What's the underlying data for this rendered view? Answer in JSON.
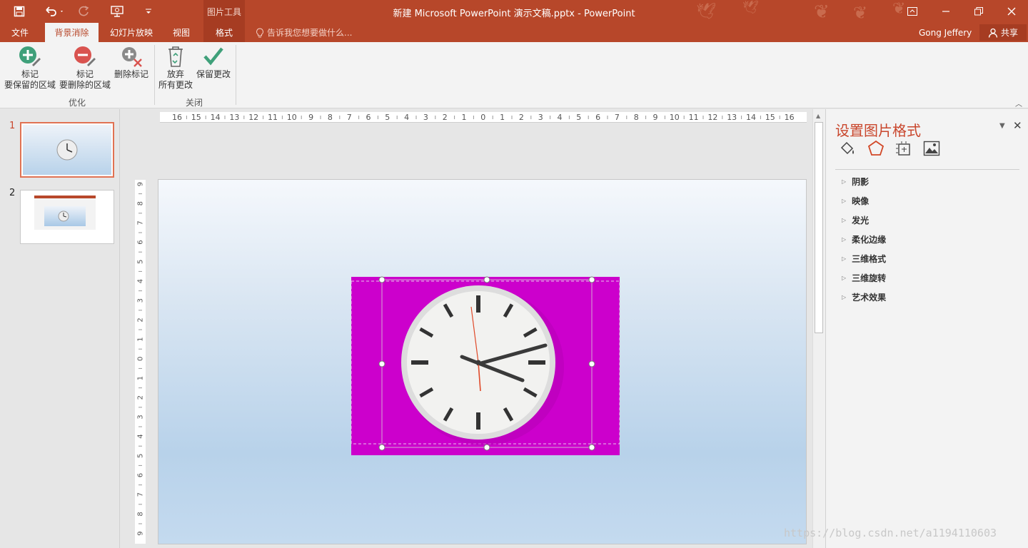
{
  "window": {
    "title": "新建 Microsoft PowerPoint 演示文稿.pptx - PowerPoint",
    "context_tools_label": "图片工具"
  },
  "tabs": [
    {
      "label": "文件",
      "active": false
    },
    {
      "label": "背景消除",
      "active": true
    },
    {
      "label": "幻灯片放映",
      "active": false
    },
    {
      "label": "视图",
      "active": false
    },
    {
      "label": "格式",
      "active": false
    }
  ],
  "tell_me": "告诉我您想要做什么...",
  "user_name": "Gong Jeffery",
  "share_label": "共享",
  "ribbon": {
    "group_refine": {
      "label": "优化",
      "mark_keep": [
        "标记",
        "要保留的区域"
      ],
      "mark_remove": [
        "标记",
        "要删除的区域"
      ],
      "delete_mark": "删除标记"
    },
    "group_close": {
      "label": "关闭",
      "discard": [
        "放弃",
        "所有更改"
      ],
      "keep": "保留更改"
    }
  },
  "slides": [
    {
      "number": "1",
      "selected": true
    },
    {
      "number": "2",
      "selected": false
    }
  ],
  "ruler": {
    "h_labels": [
      "16",
      "15",
      "14",
      "13",
      "12",
      "11",
      "10",
      "9",
      "8",
      "7",
      "6",
      "5",
      "4",
      "3",
      "2",
      "1",
      "0",
      "1",
      "2",
      "3",
      "4",
      "5",
      "6",
      "7",
      "8",
      "9",
      "10",
      "11",
      "12",
      "13",
      "14",
      "15",
      "16"
    ],
    "v_labels": [
      "9",
      "8",
      "7",
      "6",
      "5",
      "4",
      "3",
      "2",
      "1",
      "0",
      "1",
      "2",
      "3",
      "4",
      "5",
      "6",
      "7",
      "8",
      "9"
    ]
  },
  "format_pane": {
    "title": "设置图片格式",
    "sections": [
      "阴影",
      "映像",
      "发光",
      "柔化边缘",
      "三维格式",
      "三维旋转",
      "艺术效果"
    ]
  },
  "colors": {
    "accent": "#b7472a",
    "removed_area": "#cc00cc",
    "pane_title": "#c9462c"
  },
  "watermark": "https://blog.csdn.net/a1194110603"
}
